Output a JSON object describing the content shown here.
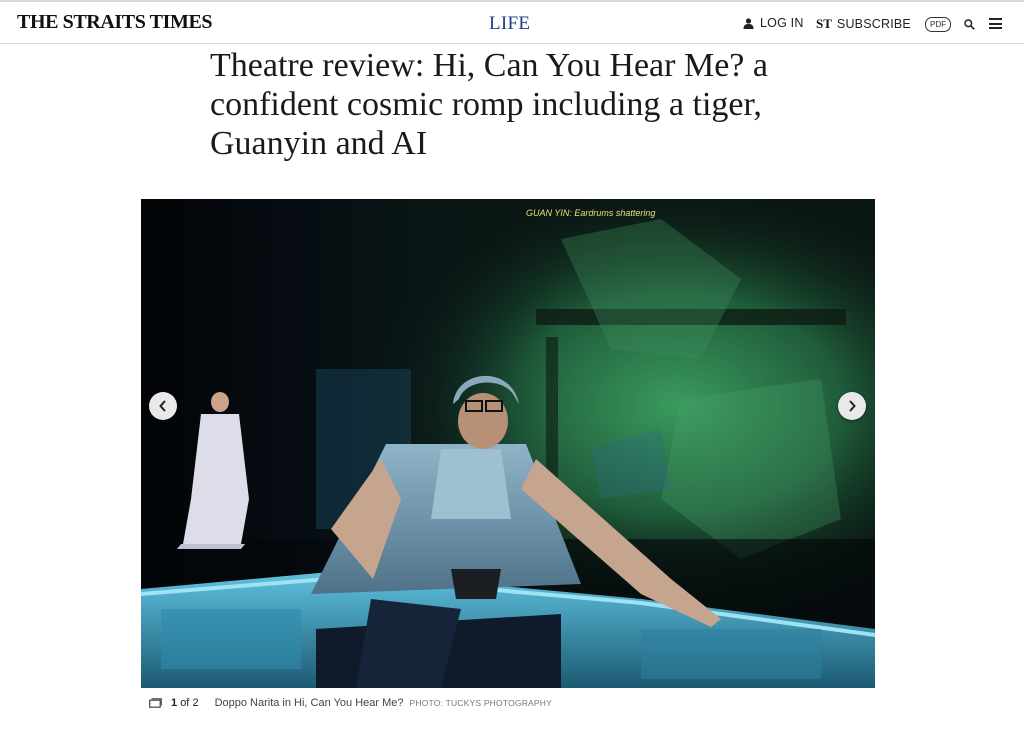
{
  "header": {
    "logo": "THE STRAITS TIMES",
    "section": "LIFE",
    "login_label": "LOG IN",
    "subscribe_mark": "ST",
    "subscribe_label": "SUBSCRIBE",
    "pdf_label": "PDF",
    "icons": {
      "login": "user-icon",
      "search": "search-icon",
      "menu": "hamburger-menu-icon"
    }
  },
  "article": {
    "headline": "Theatre review: Hi, Can You Hear Me? a confident cosmic romp including a tiger, Guanyin and AI"
  },
  "gallery": {
    "surtitle": "GUAN YIN: Eardrums shattering",
    "counter_current": "1",
    "counter_total": "2",
    "counter_separator": "of",
    "caption": "Doppo Narita in Hi, Can You Hear Me?",
    "credit_prefix": "PHOTO:",
    "credit": "TUCKYS PHOTOGRAPHY",
    "icons": {
      "prev": "chevron-left-icon",
      "next": "chevron-right-icon",
      "gallery": "gallery-icon"
    }
  },
  "colors": {
    "section": "#233a8c",
    "accent_stage": "#2e7d4f",
    "text": "#1a1a1a"
  }
}
